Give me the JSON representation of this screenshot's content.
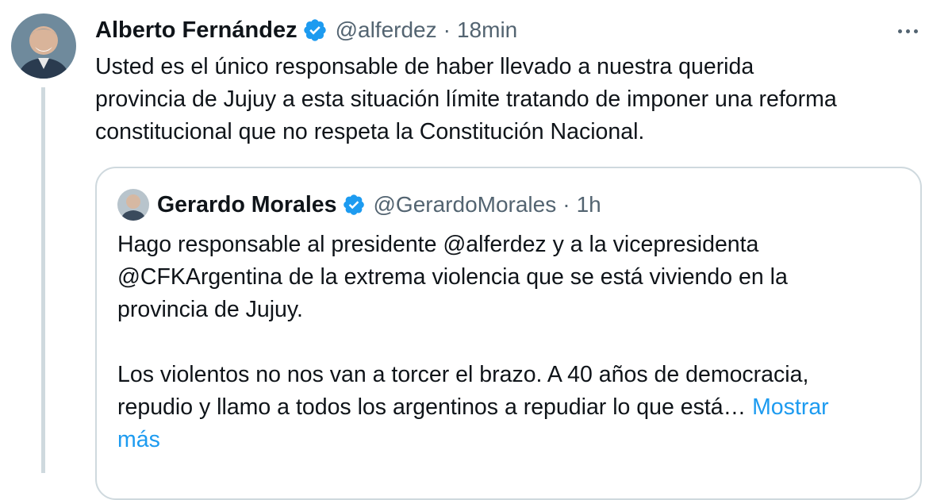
{
  "tweet": {
    "author_name": "Alberto Fernández",
    "handle": "@alferdez",
    "separator": "·",
    "time": "18min",
    "text": "Usted es el único responsable de haber llevado a nuestra querida\nprovincia de Jujuy a esta situación límite tratando de imponer una reforma\nconstitucional que no respeta la Constitución Nacional."
  },
  "quoted_tweet": {
    "author_name": "Gerardo Morales",
    "handle": "@GerardoMorales",
    "separator": "·",
    "time": "1h",
    "text": "Hago responsable al presidente @alferdez y a la vicepresidenta\n@CFKArgentina de la extrema violencia que se está viviendo en la\nprovincia de Jujuy.\n\nLos violentos no nos van a torcer el brazo. A 40 años de democracia,\nrepudio y llamo a todos los argentinos a repudiar lo que está… ",
    "show_more_label": "Mostrar\nmás"
  },
  "icons": {
    "verified": "verified-badge-icon",
    "more": "more-options-icon"
  },
  "colors": {
    "verified": "#1d9bf0",
    "link": "#1d9bf0",
    "secondary_text": "#536471",
    "border": "#cfd9de"
  }
}
